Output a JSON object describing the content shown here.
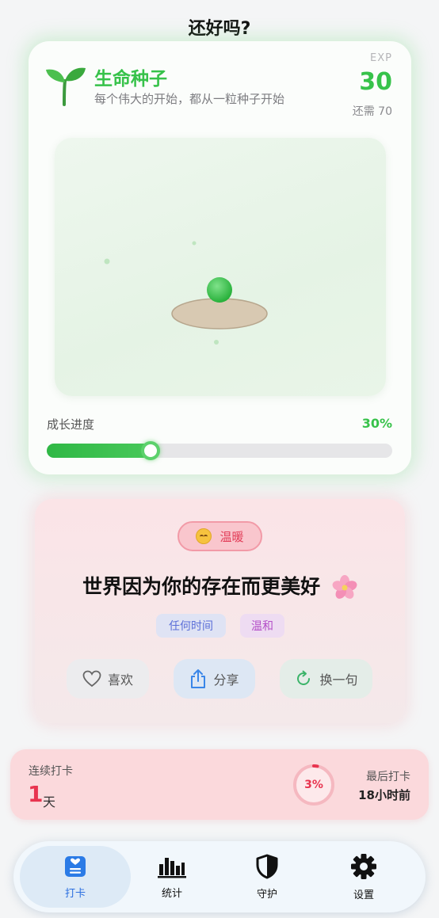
{
  "header": {
    "title": "还好吗?"
  },
  "plant": {
    "name": "生命种子",
    "subtitle": "每个伟大的开始，都从一粒种子开始",
    "exp_label": "EXP",
    "exp_value": "30",
    "exp_needed": "还需 70",
    "progress_label": "成长进度",
    "progress_text": "30%",
    "progress_fraction": 0.3,
    "accent_color": "#37c24a"
  },
  "quote": {
    "mood_icon": "smiling-face-icon",
    "mood_label": "温暖",
    "text": "世界因为你的存在而更美好",
    "decoration_icon": "cherry-blossom-icon",
    "tags": {
      "time": "任何时间",
      "tone": "温和"
    },
    "actions": {
      "like": "喜欢",
      "share": "分享",
      "refresh": "换一句"
    }
  },
  "streak": {
    "label": "连续打卡",
    "days": "1",
    "unit": "天",
    "ring_text": "3%",
    "ring_fraction": 0.03,
    "last_label": "最后打卡",
    "last_value": "18小时前",
    "accent_color": "#e8344f"
  },
  "tabs": [
    {
      "label": "打卡",
      "icon": "checkin-card-icon",
      "active": true
    },
    {
      "label": "统计",
      "icon": "bar-chart-icon",
      "active": false
    },
    {
      "label": "守护",
      "icon": "shield-icon",
      "active": false
    },
    {
      "label": "设置",
      "icon": "gear-icon",
      "active": false
    }
  ]
}
